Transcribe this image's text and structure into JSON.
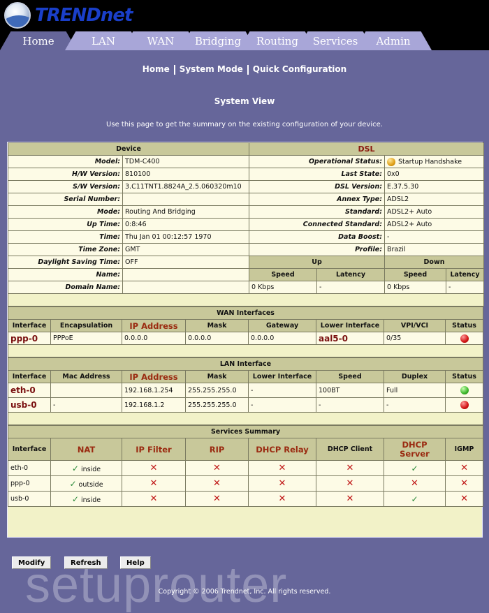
{
  "brand": {
    "name": "TRENDnet",
    "logo_icon": "trendnet-globe-icon"
  },
  "tabs": [
    {
      "label": "Home",
      "active": true
    },
    {
      "label": "LAN",
      "active": false
    },
    {
      "label": "WAN",
      "active": false
    },
    {
      "label": "Bridging",
      "active": false
    },
    {
      "label": "Routing",
      "active": false
    },
    {
      "label": "Services",
      "active": false
    },
    {
      "label": "Admin",
      "active": false
    }
  ],
  "subnav": [
    "Home",
    "System Mode",
    "Quick Configuration"
  ],
  "page": {
    "title": "System View",
    "description": "Use this page to get the summary on the existing configuration of your device."
  },
  "device": {
    "header": "Device",
    "rows": [
      {
        "label": "Model:",
        "value": "TDM-C400"
      },
      {
        "label": "H/W Version:",
        "value": "810100"
      },
      {
        "label": "S/W Version:",
        "value": "3.C11TNT1.8824A_2.5.060320m10"
      },
      {
        "label": "Serial Number:",
        "value": ""
      },
      {
        "label": "Mode:",
        "value": "Routing And Bridging"
      },
      {
        "label": "Up Time:",
        "value": "0:8:46"
      },
      {
        "label": "Time:",
        "value": "Thu Jan 01 00:12:57 1970"
      },
      {
        "label": "Time Zone:",
        "value": "GMT"
      },
      {
        "label": "Daylight Saving Time:",
        "value": "OFF"
      },
      {
        "label": "Name:",
        "value": ""
      },
      {
        "label": "Domain Name:",
        "value": ""
      }
    ]
  },
  "dsl": {
    "header": "DSL",
    "rows": [
      {
        "label": "Operational Status:",
        "value": "Startup Handshake",
        "status_icon": "amber"
      },
      {
        "label": "Last State:",
        "value": "0x0"
      },
      {
        "label": "DSL Version:",
        "value": "E.37.5.30"
      },
      {
        "label": "Annex Type:",
        "value": "ADSL2"
      },
      {
        "label": "Standard:",
        "value": "ADSL2+ Auto"
      },
      {
        "label": "Connected Standard:",
        "value": "ADSL2+ Auto"
      },
      {
        "label": "Data Boost:",
        "value": "-"
      },
      {
        "label": "Profile:",
        "value": "Brazil"
      }
    ],
    "up_label": "Up",
    "down_label": "Down",
    "speed_label": "Speed",
    "latency_label": "Latency",
    "up_speed": "0 Kbps",
    "up_latency": "-",
    "down_speed": "0 Kbps",
    "down_latency": "-"
  },
  "wan": {
    "header": "WAN Interfaces",
    "columns": [
      "Interface",
      "Encapsulation",
      "IP Address",
      "Mask",
      "Gateway",
      "Lower Interface",
      "VPI/VCI",
      "Status"
    ],
    "rows": [
      {
        "interface": "ppp-0",
        "encapsulation": "PPPoE",
        "ip": "0.0.0.0",
        "mask": "0.0.0.0",
        "gateway": "0.0.0.0",
        "lower": "aal5-0",
        "vpivci": "0/35",
        "status": "red"
      }
    ]
  },
  "lan": {
    "header": "LAN Interface",
    "columns": [
      "Interface",
      "Mac Address",
      "IP Address",
      "Mask",
      "Lower Interface",
      "Speed",
      "Duplex",
      "Status"
    ],
    "rows": [
      {
        "interface": "eth-0",
        "mac": "",
        "ip": "192.168.1.254",
        "mask": "255.255.255.0",
        "lower": "-",
        "speed": "100BT",
        "duplex": "Full",
        "status": "green"
      },
      {
        "interface": "usb-0",
        "mac": "-",
        "ip": "192.168.1.2",
        "mask": "255.255.255.0",
        "lower": "-",
        "speed": "-",
        "duplex": "-",
        "status": "red"
      }
    ]
  },
  "services": {
    "header": "Services Summary",
    "columns": [
      "Interface",
      "NAT",
      "IP Filter",
      "RIP",
      "DHCP Relay",
      "DHCP Client",
      "DHCP Server",
      "IGMP"
    ],
    "rows": [
      {
        "interface": "eth-0",
        "nat": "inside",
        "ip_filter": "x",
        "rip": "x",
        "dhcp_relay": "x",
        "dhcp_client": "x",
        "dhcp_server": "check",
        "igmp": "x"
      },
      {
        "interface": "ppp-0",
        "nat": "outside",
        "ip_filter": "x",
        "rip": "x",
        "dhcp_relay": "x",
        "dhcp_client": "x",
        "dhcp_server": "x",
        "igmp": "x"
      },
      {
        "interface": "usb-0",
        "nat": "inside",
        "ip_filter": "x",
        "rip": "x",
        "dhcp_relay": "x",
        "dhcp_client": "x",
        "dhcp_server": "check",
        "igmp": "x"
      }
    ]
  },
  "buttons": {
    "modify": "Modify",
    "refresh": "Refresh",
    "help": "Help"
  },
  "watermark": "setuprouter",
  "copyright": "Copyright © 2006 Trendnet, Inc. All rights reserved.",
  "symbols": {
    "check": "✓",
    "cross": "✕"
  },
  "colors": {
    "background": "#66669a",
    "tab": "#a8a6d8",
    "panel": "#f2f2c8",
    "header": "#c8c89a",
    "cell": "#fdfbe6",
    "link_red": "#7a1010"
  }
}
